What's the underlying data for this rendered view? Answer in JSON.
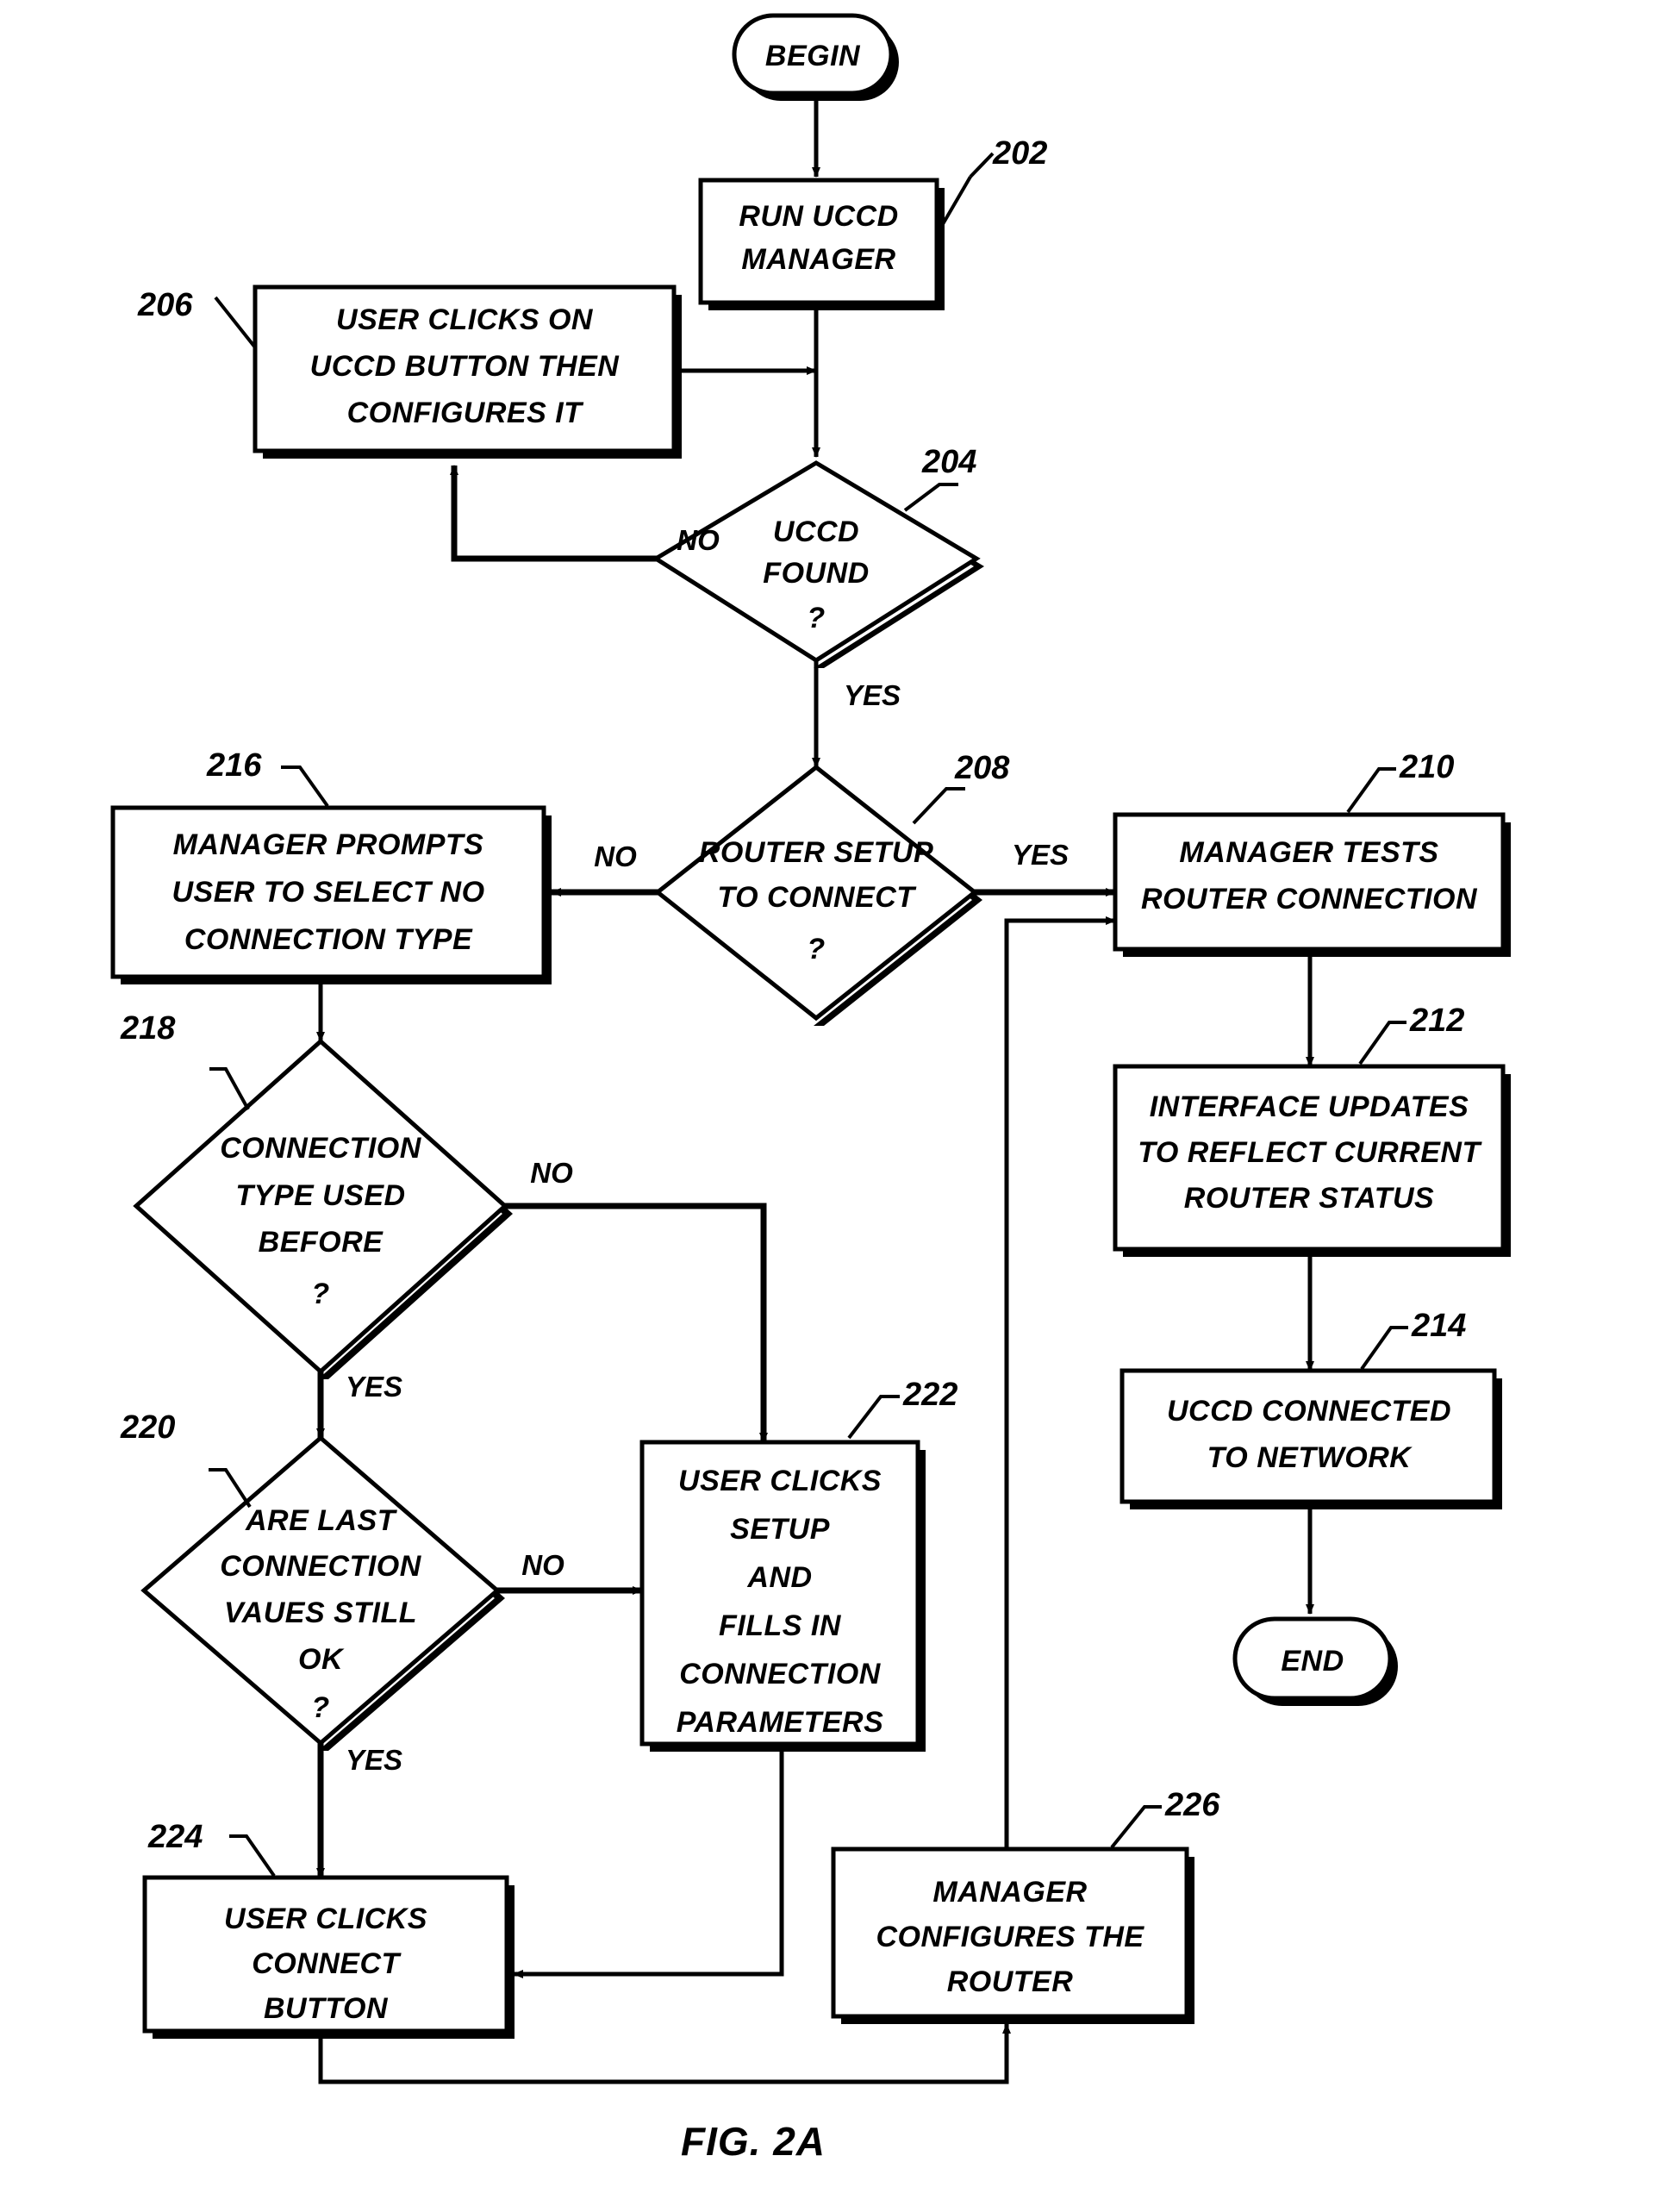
{
  "figure": {
    "caption": "FIG. 2A",
    "type": "flowchart"
  },
  "terminators": {
    "begin": "BEGIN",
    "end": "END"
  },
  "branch_labels": {
    "no": "NO",
    "yes": "YES"
  },
  "nodes": [
    {
      "ref": "202",
      "shape": "process",
      "lines": [
        "RUN UCCD",
        "MANAGER"
      ]
    },
    {
      "ref": "206",
      "shape": "process",
      "lines": [
        "USER CLICKS ON",
        "UCCD BUTTON THEN",
        "CONFIGURES IT"
      ]
    },
    {
      "ref": "204",
      "shape": "decision",
      "lines": [
        "UCCD",
        "FOUND",
        "?"
      ]
    },
    {
      "ref": "208",
      "shape": "decision",
      "lines": [
        "ROUTER SETUP",
        "TO CONNECT",
        "?"
      ]
    },
    {
      "ref": "210",
      "shape": "process",
      "lines": [
        "MANAGER TESTS",
        "ROUTER CONNECTION"
      ]
    },
    {
      "ref": "212",
      "shape": "process",
      "lines": [
        "INTERFACE UPDATES",
        "TO REFLECT CURRENT",
        "ROUTER STATUS"
      ]
    },
    {
      "ref": "214",
      "shape": "process",
      "lines": [
        "UCCD CONNECTED",
        "TO NETWORK"
      ]
    },
    {
      "ref": "216",
      "shape": "process",
      "lines": [
        "MANAGER PROMPTS",
        "USER TO SELECT NO",
        "CONNECTION TYPE"
      ]
    },
    {
      "ref": "218",
      "shape": "decision",
      "lines": [
        "CONNECTION",
        "TYPE USED",
        "BEFORE",
        "?"
      ]
    },
    {
      "ref": "220",
      "shape": "decision",
      "lines": [
        "ARE LAST",
        "CONNECTION",
        "VAUES STILL",
        "OK",
        "?"
      ]
    },
    {
      "ref": "222",
      "shape": "process",
      "lines": [
        "USER CLICKS",
        "SETUP",
        "AND",
        "FILLS IN",
        "CONNECTION",
        "PARAMETERS"
      ]
    },
    {
      "ref": "224",
      "shape": "process",
      "lines": [
        "USER CLICKS",
        "CONNECT",
        "BUTTON"
      ]
    },
    {
      "ref": "226",
      "shape": "process",
      "lines": [
        "MANAGER",
        "CONFIGURES THE",
        "ROUTER"
      ]
    }
  ],
  "edges": [
    {
      "from": "BEGIN",
      "to": "202",
      "label": ""
    },
    {
      "from": "202",
      "to": "204",
      "label": ""
    },
    {
      "from": "204",
      "to": "206",
      "label": "NO"
    },
    {
      "from": "206",
      "to": "202-path",
      "label": ""
    },
    {
      "from": "204",
      "to": "208",
      "label": "YES"
    },
    {
      "from": "208",
      "to": "210",
      "label": "YES"
    },
    {
      "from": "208",
      "to": "216",
      "label": "NO"
    },
    {
      "from": "210",
      "to": "212",
      "label": ""
    },
    {
      "from": "212",
      "to": "214",
      "label": ""
    },
    {
      "from": "214",
      "to": "END",
      "label": ""
    },
    {
      "from": "216",
      "to": "218",
      "label": ""
    },
    {
      "from": "218",
      "to": "222",
      "label": "NO"
    },
    {
      "from": "218",
      "to": "220",
      "label": "YES"
    },
    {
      "from": "220",
      "to": "222",
      "label": "NO"
    },
    {
      "from": "220",
      "to": "224",
      "label": "YES"
    },
    {
      "from": "222",
      "to": "224",
      "label": ""
    },
    {
      "from": "224",
      "to": "226",
      "label": ""
    },
    {
      "from": "226",
      "to": "210",
      "label": ""
    }
  ],
  "text": {
    "begin": "BEGIN",
    "end": "END",
    "caption": "FIG. 2A",
    "n202_l1": "RUN UCCD",
    "n202_l2": "MANAGER",
    "n206_l1": "USER CLICKS ON",
    "n206_l2": "UCCD BUTTON THEN",
    "n206_l3": "CONFIGURES IT",
    "n204_l1": "UCCD",
    "n204_l2": "FOUND",
    "n204_l3": "?",
    "n208_l1": "ROUTER SETUP",
    "n208_l2": "TO CONNECT",
    "n208_l3": "?",
    "n210_l1": "MANAGER TESTS",
    "n210_l2": "ROUTER CONNECTION",
    "n212_l1": "INTERFACE UPDATES",
    "n212_l2": "TO REFLECT CURRENT",
    "n212_l3": "ROUTER STATUS",
    "n214_l1": "UCCD CONNECTED",
    "n214_l2": "TO NETWORK",
    "n216_l1": "MANAGER PROMPTS",
    "n216_l2": "USER TO SELECT NO",
    "n216_l3": "CONNECTION TYPE",
    "n218_l1": "CONNECTION",
    "n218_l2": "TYPE USED",
    "n218_l3": "BEFORE",
    "n218_l4": "?",
    "n220_l1": "ARE LAST",
    "n220_l2": "CONNECTION",
    "n220_l3": "VAUES STILL",
    "n220_l4": "OK",
    "n220_l5": "?",
    "n222_l1": "USER CLICKS",
    "n222_l2": "SETUP",
    "n222_l3": "AND",
    "n222_l4": "FILLS IN",
    "n222_l5": "CONNECTION",
    "n222_l6": "PARAMETERS",
    "n224_l1": "USER CLICKS",
    "n224_l2": "CONNECT",
    "n224_l3": "BUTTON",
    "n226_l1": "MANAGER",
    "n226_l2": "CONFIGURES THE",
    "n226_l3": "ROUTER",
    "ref202": "202",
    "ref204": "204",
    "ref206": "206",
    "ref208": "208",
    "ref210": "210",
    "ref212": "212",
    "ref214": "214",
    "ref216": "216",
    "ref218": "218",
    "ref220": "220",
    "ref222": "222",
    "ref224": "224",
    "ref226": "226",
    "no1": "NO",
    "no2": "NO",
    "no3": "NO",
    "no4": "NO",
    "yes1": "YES",
    "yes2": "YES",
    "yes3": "YES",
    "yes4": "YES"
  }
}
